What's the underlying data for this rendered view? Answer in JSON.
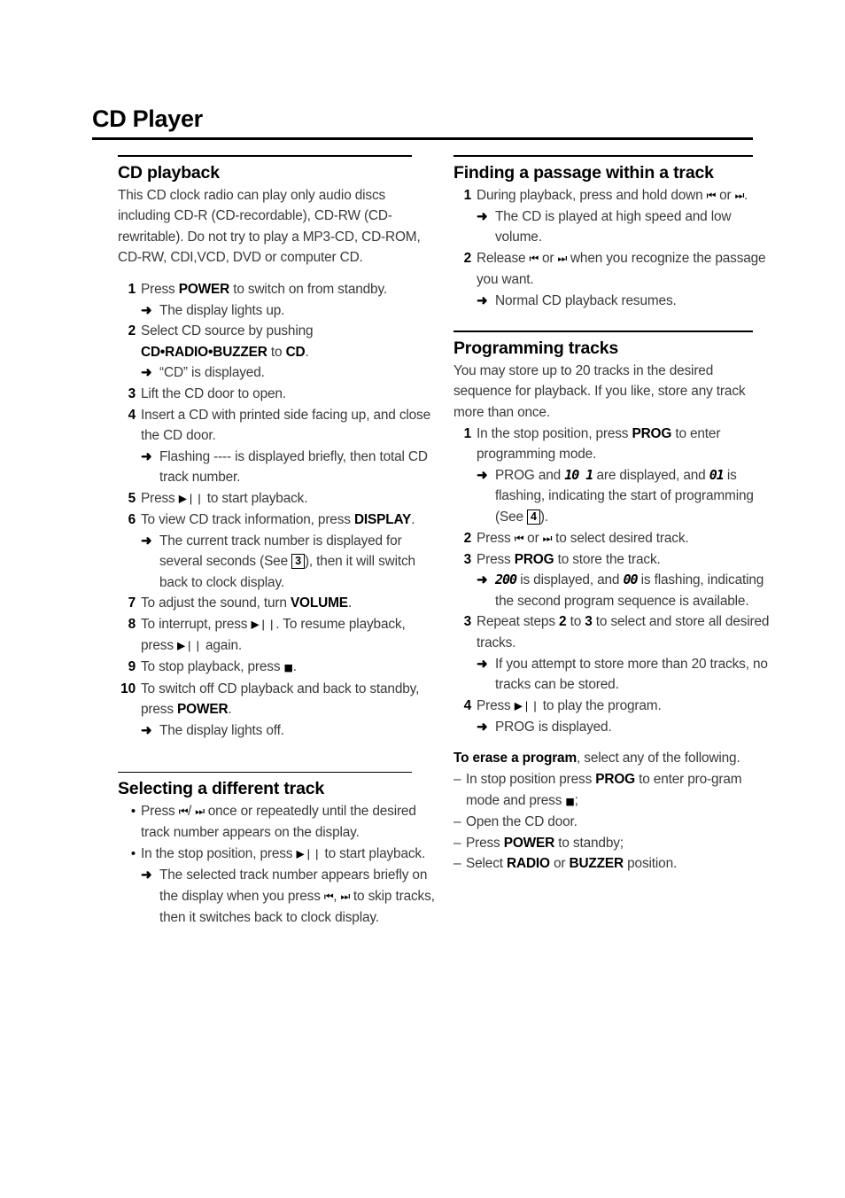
{
  "document": {
    "title": "CD Player"
  },
  "icons": {
    "prev": "⏮",
    "next": "⏭",
    "play_pause": "▶❘❘",
    "stop": "■",
    "arrow": "➜",
    "bullet": "•",
    "dash": "–"
  },
  "left_column": {
    "sections": [
      {
        "id": "cd-playback",
        "heading": "CD playback",
        "intro": "This CD clock radio can play only audio discs including CD-R (CD-recordable), CD-RW (CD-rewritable). Do not try to play a MP3-CD, CD-ROM, CD-RW, CDI,VCD, DVD or computer CD.",
        "steps": [
          {
            "num": "1",
            "text_1": "Press ",
            "bold_1": "POWER",
            "text_2": " to switch on from standby.",
            "results": [
              {
                "text": "The display lights up."
              }
            ]
          },
          {
            "num": "2",
            "text_1": "Select CD source by pushing ",
            "bold_1": "CD•RADIO•BUZZER",
            "text_2": " to ",
            "bold_2": "CD",
            "text_3": ".",
            "results": [
              {
                "text": "“CD” is displayed."
              }
            ]
          },
          {
            "num": "3",
            "text_1": "Lift the CD door to open.",
            "results": []
          },
          {
            "num": "4",
            "text_1": "Insert a CD with printed side facing up, and close the CD door.",
            "results": [
              {
                "text": "Flashing ---- is displayed briefly, then total CD track number."
              }
            ]
          },
          {
            "num": "5",
            "text_1": "Press ",
            "glyph_1": "play_pause",
            "text_2": " to start playback.",
            "results": []
          },
          {
            "num": "6",
            "text_1": "To view CD track information, press ",
            "bold_1": "DISPLAY",
            "text_2": ".",
            "results": [
              {
                "text_1": "The current track number is displayed for several seconds (See ",
                "ref": "3",
                "text_2": "), then it will switch back to clock display."
              }
            ]
          },
          {
            "num": "7",
            "text_1": "To adjust the sound, turn ",
            "bold_1": "VOLUME",
            "text_2": ".",
            "results": []
          },
          {
            "num": "8",
            "text_1": "To interrupt, press ",
            "glyph_1": "play_pause",
            "text_2": ". To resume playback, press ",
            "glyph_2": "play_pause",
            "text_3": " again.",
            "results": []
          },
          {
            "num": "9",
            "text_1": "To stop playback, press ",
            "glyph_stop": "stop",
            "text_2": ".",
            "results": []
          },
          {
            "num": "10",
            "text_1": "To switch off CD playback and back to standby, press ",
            "bold_1": "POWER",
            "text_2": ".",
            "results": [
              {
                "text": "The display lights off."
              }
            ]
          }
        ]
      },
      {
        "id": "selecting-different-track",
        "heading": "Selecting a different track",
        "bullets": [
          {
            "text_1": "Press ",
            "glyph_1": "prev",
            "text_sep": "/ ",
            "glyph_2": "next",
            "text_2": "  once or repeatedly until the desired track number appears on the display.",
            "results": []
          },
          {
            "text_1": "In the stop position, press ",
            "glyph_1": "play_pause",
            "text_2": " to start playback.",
            "results": [
              {
                "text_1": "The selected track number appears briefly on the display when you press ",
                "glyph_1": "prev",
                "text_mid": ", ",
                "glyph_2": "next",
                "text_2": " to skip tracks, then it switches back to clock display."
              }
            ]
          }
        ]
      }
    ]
  },
  "right_column": {
    "sections": [
      {
        "id": "finding-passage",
        "heading": "Finding a passage within a track",
        "steps": [
          {
            "num": "1",
            "text_1": "During playback, press and hold down ",
            "glyph_1": "prev",
            "text_mid": " or ",
            "glyph_2": "next",
            "text_2": ".",
            "results": [
              {
                "text": "The CD is played at high speed and low volume."
              }
            ]
          },
          {
            "num": "2",
            "text_1": "Release ",
            "glyph_1": "prev",
            "text_mid": " or ",
            "glyph_2": "next",
            "text_2": " when you recognize the passage you want.",
            "results": [
              {
                "text": "Normal CD playback resumes."
              }
            ]
          }
        ]
      },
      {
        "id": "programming-tracks",
        "heading": "Programming tracks",
        "intro": "You may store up to 20 tracks in the desired sequence for playback. If you like, store any track more than once.",
        "steps": [
          {
            "num": "1",
            "text_1": "In the stop position, press ",
            "bold_1": "PROG",
            "text_2": " to enter programming mode.",
            "results": [
              {
                "text_1": "PROG and ",
                "lcd_1": "10 1",
                "text_2": " are displayed, and ",
                "lcd_2": "01",
                "text_3": " is flashing, indicating the start of programming (See ",
                "ref": "4",
                "text_4": ")."
              }
            ]
          },
          {
            "num": "2",
            "text_1": "Press ",
            "glyph_1": "prev",
            "text_mid": " or ",
            "glyph_2": "next",
            "text_2": " to select desired track.",
            "results": []
          },
          {
            "num": "3",
            "text_1": "Press ",
            "bold_1": "PROG",
            "text_2": " to store the track.",
            "results": [
              {
                "lcd_1": "200",
                "text_2": " is displayed, and ",
                "lcd_2": "00",
                "text_3": " is flashing, indicating the second program sequence is available."
              }
            ]
          },
          {
            "num": "3",
            "text_1": "Repeat steps ",
            "bold_1": "2",
            "text_mid": " to ",
            "bold_2": "3",
            "text_2": " to select and store all desired tracks.",
            "results": [
              {
                "text": "If you attempt to store more than 20 tracks, no tracks can be stored."
              }
            ]
          },
          {
            "num": "4",
            "text_1": "Press ",
            "glyph_1": "play_pause",
            "text_2": " to play the program.",
            "results": [
              {
                "text": "PROG is displayed."
              }
            ]
          }
        ],
        "erase": {
          "lead_bold": "To erase a program",
          "lead_text": ", select any of the following.",
          "items": [
            {
              "text_1": "In stop position press ",
              "bold_1": "PROG",
              "text_2": " to enter pro-gram mode and press ",
              "glyph_stop": "stop",
              "text_3": ";"
            },
            {
              "text_1": "Open the CD door."
            },
            {
              "text_1": "Press ",
              "bold_1": "POWER",
              "text_2": " to standby;"
            },
            {
              "text_1": "Select ",
              "bold_1": "RADIO",
              "text_mid": " or ",
              "bold_2": "BUZZER",
              "text_2": " position."
            }
          ]
        }
      }
    ]
  }
}
